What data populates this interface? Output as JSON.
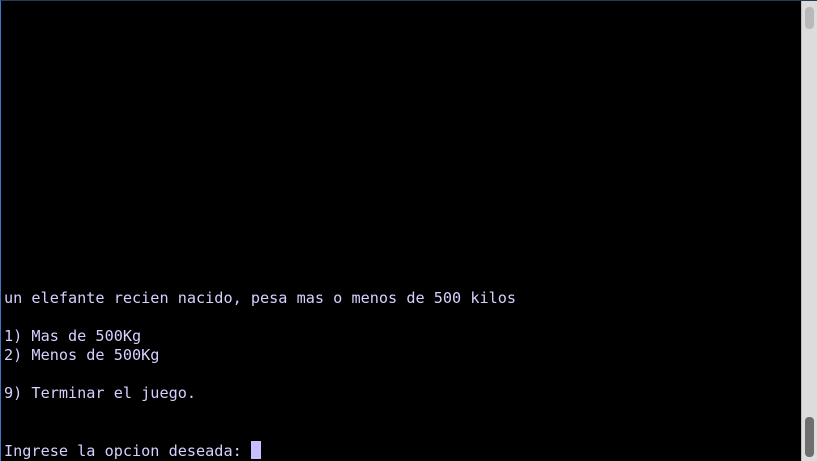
{
  "terminal": {
    "lines": {
      "question": "un elefante recien nacido, pesa mas o menos de 500 kilos",
      "option1": "1) Mas de 500Kg",
      "option2": "2) Menos de 500Kg",
      "option9": "9) Terminar el juego.",
      "prompt": "Ingrese la opcion deseada: "
    },
    "colors": {
      "background": "#000000",
      "text": "#d6d0ff",
      "cursor": "#c7bfff"
    }
  },
  "scrollbar": {
    "position_fraction": 1.0
  }
}
